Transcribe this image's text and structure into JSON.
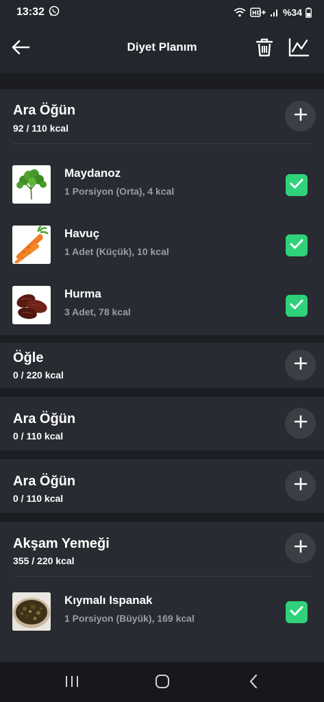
{
  "status_bar": {
    "time": "13:32",
    "battery": "%34",
    "icons": [
      "whatsapp-icon",
      "wifi-icon",
      "hd-plus-icon",
      "signal-icon",
      "battery-icon"
    ]
  },
  "app_bar": {
    "title": "Diyet Planım",
    "icons": [
      "back-arrow-icon",
      "trash-icon",
      "chart-icon"
    ]
  },
  "meals": [
    {
      "title": "Ara Öğün",
      "kcal": "92 / 110 kcal",
      "items": [
        {
          "name": "Maydanoz",
          "detail": "1 Porsiyon (Orta), 4 kcal",
          "checked": true,
          "image": "parsley"
        },
        {
          "name": "Havuç",
          "detail": "1 Adet (Küçük), 10 kcal",
          "checked": true,
          "image": "carrot"
        },
        {
          "name": "Hurma",
          "detail": "3 Adet, 78 kcal",
          "checked": true,
          "image": "dates"
        }
      ]
    },
    {
      "title": "Öğle",
      "kcal": "0 / 220 kcal",
      "items": []
    },
    {
      "title": "Ara Öğün",
      "kcal": "0 / 110 kcal",
      "items": []
    },
    {
      "title": "Ara Öğün",
      "kcal": "0 / 110 kcal",
      "items": []
    },
    {
      "title": "Akşam Yemeği",
      "kcal": "355 / 220 kcal",
      "items": [
        {
          "name": "Kıymalı Ispanak",
          "detail": "1 Porsiyon (Büyük), 169 kcal",
          "checked": true,
          "image": "spinach-with-mince"
        }
      ]
    }
  ],
  "colors": {
    "background": "#1b1d22",
    "card": "#282b31",
    "header": "#23262c",
    "add_button": "#3b3e45",
    "check_green": "#2fd27a",
    "secondary_text": "#9a9da4"
  },
  "nav_bar": {
    "icons": [
      "recent-apps-icon",
      "home-icon",
      "back-icon"
    ]
  }
}
